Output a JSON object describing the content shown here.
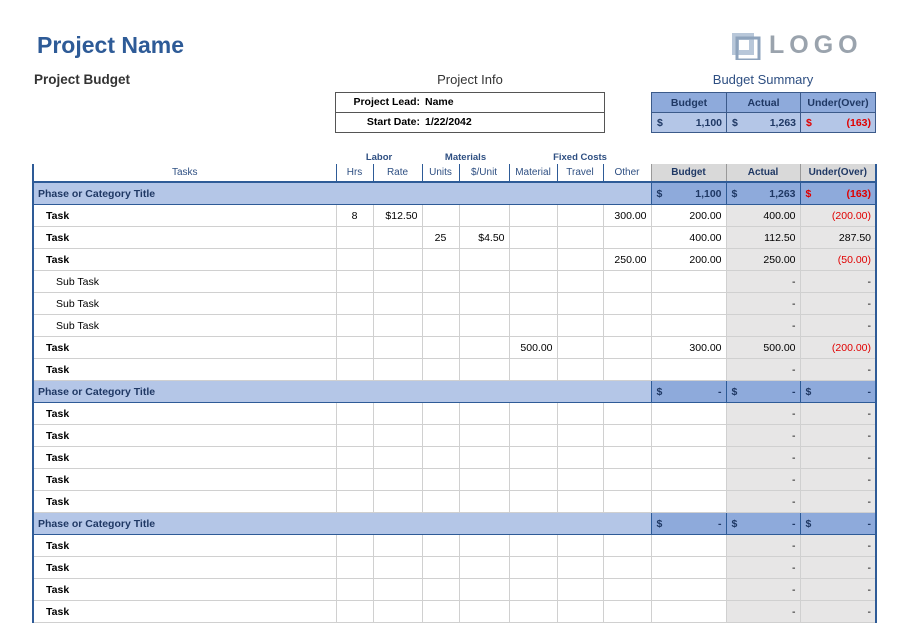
{
  "header": {
    "title": "Project Name",
    "subtitle": "Project Budget",
    "info_heading": "Project Info",
    "summary_heading": "Budget Summary",
    "logo_text": "LOGO"
  },
  "project_info": {
    "lead_label": "Project Lead:",
    "lead_value": "Name",
    "start_label": "Start Date:",
    "start_value": "1/22/2042"
  },
  "summary": {
    "headers": [
      "Budget",
      "Actual",
      "Under(Over)"
    ],
    "budget_cur": "$",
    "budget": "1,100",
    "actual_cur": "$",
    "actual": "1,263",
    "under_cur": "$",
    "under": "(163)"
  },
  "table": {
    "groups": {
      "labor": "Labor",
      "materials": "Materials",
      "fixed": "Fixed Costs"
    },
    "columns": [
      "Tasks",
      "Hrs",
      "Rate",
      "Units",
      "$/Unit",
      "Material",
      "Travel",
      "Other",
      "Budget",
      "Actual",
      "Under(Over)"
    ],
    "phases": [
      {
        "title": "Phase or Category Title",
        "budget_cur": "$",
        "budget": "1,100",
        "actual_cur": "$",
        "actual": "1,263",
        "under_cur": "$",
        "under": "(163)",
        "rows": [
          {
            "name": "Task",
            "sub": false,
            "hrs": "8",
            "rate": "$12.50",
            "units": "",
            "per_unit": "",
            "material": "",
            "travel": "",
            "other": "300.00",
            "budget": "200.00",
            "actual": "400.00",
            "under": "(200.00)"
          },
          {
            "name": "Task",
            "sub": false,
            "hrs": "",
            "rate": "",
            "units": "25",
            "per_unit": "$4.50",
            "material": "",
            "travel": "",
            "other": "",
            "budget": "400.00",
            "actual": "112.50",
            "under": "287.50"
          },
          {
            "name": "Task",
            "sub": false,
            "hrs": "",
            "rate": "",
            "units": "",
            "per_unit": "",
            "material": "",
            "travel": "",
            "other": "250.00",
            "budget": "200.00",
            "actual": "250.00",
            "under": "(50.00)"
          },
          {
            "name": "Sub Task",
            "sub": true,
            "hrs": "",
            "rate": "",
            "units": "",
            "per_unit": "",
            "material": "",
            "travel": "",
            "other": "",
            "budget": "",
            "actual": "-",
            "under": "-"
          },
          {
            "name": "Sub Task",
            "sub": true,
            "hrs": "",
            "rate": "",
            "units": "",
            "per_unit": "",
            "material": "",
            "travel": "",
            "other": "",
            "budget": "",
            "actual": "-",
            "under": "-"
          },
          {
            "name": "Sub Task",
            "sub": true,
            "hrs": "",
            "rate": "",
            "units": "",
            "per_unit": "",
            "material": "",
            "travel": "",
            "other": "",
            "budget": "",
            "actual": "-",
            "under": "-"
          },
          {
            "name": "Task",
            "sub": false,
            "hrs": "",
            "rate": "",
            "units": "",
            "per_unit": "",
            "material": "500.00",
            "travel": "",
            "other": "",
            "budget": "300.00",
            "actual": "500.00",
            "under": "(200.00)"
          },
          {
            "name": "Task",
            "sub": false,
            "hrs": "",
            "rate": "",
            "units": "",
            "per_unit": "",
            "material": "",
            "travel": "",
            "other": "",
            "budget": "",
            "actual": "-",
            "under": "-"
          }
        ]
      },
      {
        "title": "Phase or Category Title",
        "budget_cur": "$",
        "budget": "-",
        "actual_cur": "$",
        "actual": "-",
        "under_cur": "$",
        "under": "-",
        "rows": [
          {
            "name": "Task",
            "sub": false,
            "hrs": "",
            "rate": "",
            "units": "",
            "per_unit": "",
            "material": "",
            "travel": "",
            "other": "",
            "budget": "",
            "actual": "-",
            "under": "-"
          },
          {
            "name": "Task",
            "sub": false,
            "hrs": "",
            "rate": "",
            "units": "",
            "per_unit": "",
            "material": "",
            "travel": "",
            "other": "",
            "budget": "",
            "actual": "-",
            "under": "-"
          },
          {
            "name": "Task",
            "sub": false,
            "hrs": "",
            "rate": "",
            "units": "",
            "per_unit": "",
            "material": "",
            "travel": "",
            "other": "",
            "budget": "",
            "actual": "-",
            "under": "-"
          },
          {
            "name": "Task",
            "sub": false,
            "hrs": "",
            "rate": "",
            "units": "",
            "per_unit": "",
            "material": "",
            "travel": "",
            "other": "",
            "budget": "",
            "actual": "-",
            "under": "-"
          },
          {
            "name": "Task",
            "sub": false,
            "hrs": "",
            "rate": "",
            "units": "",
            "per_unit": "",
            "material": "",
            "travel": "",
            "other": "",
            "budget": "",
            "actual": "-",
            "under": "-"
          }
        ]
      },
      {
        "title": "Phase or Category Title",
        "budget_cur": "$",
        "budget": "-",
        "actual_cur": "$",
        "actual": "-",
        "under_cur": "$",
        "under": "-",
        "rows": [
          {
            "name": "Task",
            "sub": false,
            "hrs": "",
            "rate": "",
            "units": "",
            "per_unit": "",
            "material": "",
            "travel": "",
            "other": "",
            "budget": "",
            "actual": "-",
            "under": "-"
          },
          {
            "name": "Task",
            "sub": false,
            "hrs": "",
            "rate": "",
            "units": "",
            "per_unit": "",
            "material": "",
            "travel": "",
            "other": "",
            "budget": "",
            "actual": "-",
            "under": "-"
          },
          {
            "name": "Task",
            "sub": false,
            "hrs": "",
            "rate": "",
            "units": "",
            "per_unit": "",
            "material": "",
            "travel": "",
            "other": "",
            "budget": "",
            "actual": "-",
            "under": "-"
          },
          {
            "name": "Task",
            "sub": false,
            "hrs": "",
            "rate": "",
            "units": "",
            "per_unit": "",
            "material": "",
            "travel": "",
            "other": "",
            "budget": "",
            "actual": "-",
            "under": "-"
          }
        ]
      }
    ]
  },
  "colors": {
    "title_blue": "#2e5b97",
    "phase_band": "#b4c6e7",
    "summary_header": "#8eaadb",
    "negative_red": "#e00000",
    "computed_gray": "#e7e6e6"
  }
}
